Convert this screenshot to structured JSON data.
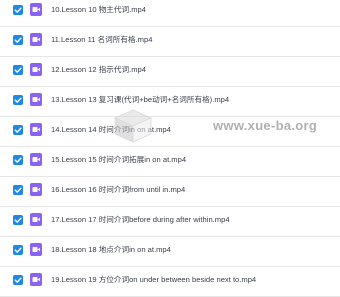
{
  "files": [
    {
      "name": "10.Lesson 10 物主代词.mp4",
      "checked": true
    },
    {
      "name": "11.Lesson 11 名词所有格.mp4",
      "checked": true
    },
    {
      "name": "12.Lesson 12 指示代词.mp4",
      "checked": true
    },
    {
      "name": "13.Lesson 13 复习课(代词+be动词+名词所有格).mp4",
      "checked": true
    },
    {
      "name": "14.Lesson 14 时间介词in on at.mp4",
      "checked": true
    },
    {
      "name": "15.Lesson 15 时间介词拓展in on at.mp4",
      "checked": true
    },
    {
      "name": "16.Lesson 16 时间介词from until in.mp4",
      "checked": true
    },
    {
      "name": "17.Lesson 17 时间介词before during after within.mp4",
      "checked": true
    },
    {
      "name": "18.Lesson 18 地点介词in on at.mp4",
      "checked": true
    },
    {
      "name": "19.Lesson 19 方位介词on under between beside next to.mp4",
      "checked": true
    }
  ],
  "watermark": "www.xue-ba.org",
  "colors": {
    "checkbox": "#1e88e5",
    "video_icon": "#8a63f2",
    "text": "#3b3f4a",
    "divider": "#e6e6e6"
  },
  "icons": {
    "checkbox": "checkmark-icon",
    "file": "video-file-icon"
  }
}
